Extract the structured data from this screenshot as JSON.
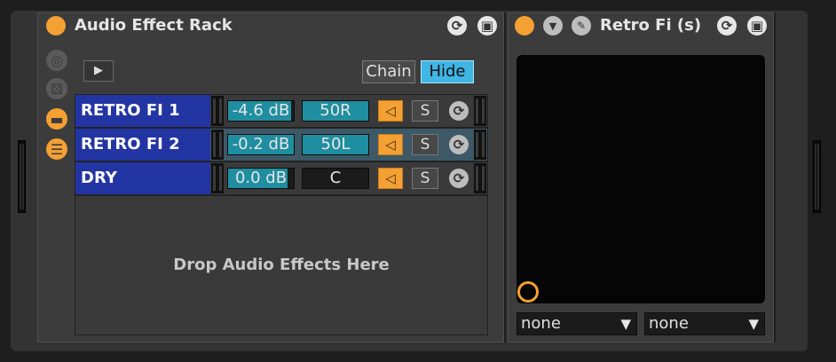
{
  "rack": {
    "title": "Audio Effect Rack",
    "chain_label": "Chain",
    "hide_label": "Hide",
    "drop_hint": "Drop Audio Effects Here",
    "chains": [
      {
        "name": "RETRO FI 1",
        "volume": "-4.6 dB",
        "volume_fill": 0.96,
        "pan": "50R",
        "pan_fill": 1.0,
        "solo": "S",
        "highlighted": false
      },
      {
        "name": "RETRO FI 2",
        "volume": "-0.2 dB",
        "volume_fill": 1.0,
        "pan": "50L",
        "pan_fill": 1.0,
        "solo": "S",
        "highlighted": true
      },
      {
        "name": "DRY",
        "volume": "0.0 dB",
        "volume_fill": 0.9,
        "pan": "C",
        "pan_fill": 0.0,
        "solo": "S",
        "highlighted": false
      }
    ]
  },
  "device": {
    "title": "Retro Fi (s)",
    "dropdown_1": "none",
    "dropdown_2": "none"
  },
  "colors": {
    "accent": "#f4a033",
    "chain_name_bg": "#2334a3",
    "hide_active": "#3fb6e4",
    "meter_fill": "#1f8ea0"
  },
  "icons": {
    "arrow_down": "▼",
    "speaker": "◁",
    "sync": "⟳",
    "save": "▣",
    "wrench": "🔧"
  }
}
